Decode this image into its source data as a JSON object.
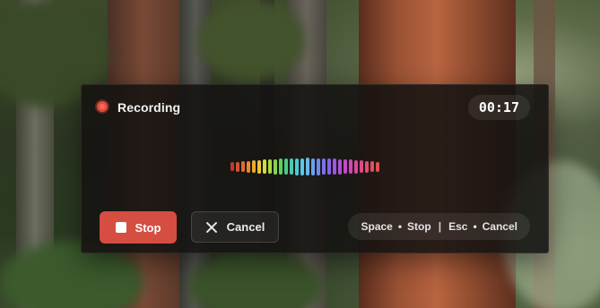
{
  "recorder": {
    "status_label": "Recording",
    "timer": "00:17",
    "waveform": {
      "levels": [
        0.5,
        0.55,
        0.6,
        0.65,
        0.7,
        0.75,
        0.8,
        0.82,
        0.85,
        0.88,
        0.9,
        0.92,
        0.95,
        0.97,
        1.0,
        0.97,
        0.95,
        0.92,
        0.9,
        0.88,
        0.85,
        0.82,
        0.8,
        0.75,
        0.7,
        0.65,
        0.6,
        0.55
      ],
      "colors": [
        "#c0392b",
        "#d4502f",
        "#e06a2e",
        "#e8892e",
        "#ecab2f",
        "#e9c933",
        "#d2dc37",
        "#a9dc3f",
        "#7fd64a",
        "#5bd063",
        "#49cc86",
        "#47ccad",
        "#4ccbd2",
        "#5ac6ea",
        "#6ab8ef",
        "#6aa0ef",
        "#6f88ee",
        "#7a73ea",
        "#8b63e6",
        "#9e57e0",
        "#b24fd6",
        "#c54ac8",
        "#d246b5",
        "#dd45a0",
        "#e24889",
        "#e24c72",
        "#e0505e",
        "#db5450"
      ]
    },
    "stop_button_label": "Stop",
    "cancel_button_label": "Cancel",
    "shortcuts": {
      "stop_key": "Space",
      "stop_action": "Stop",
      "separator": "|",
      "cancel_key": "Esc",
      "cancel_action": "Cancel",
      "dot": "•"
    },
    "icons": {
      "status": "recording-dot-icon",
      "stop": "stop-square-icon",
      "cancel": "close-icon"
    },
    "colors": {
      "accent_stop": "#d64d42",
      "status_dot": "#e34b3f"
    }
  }
}
